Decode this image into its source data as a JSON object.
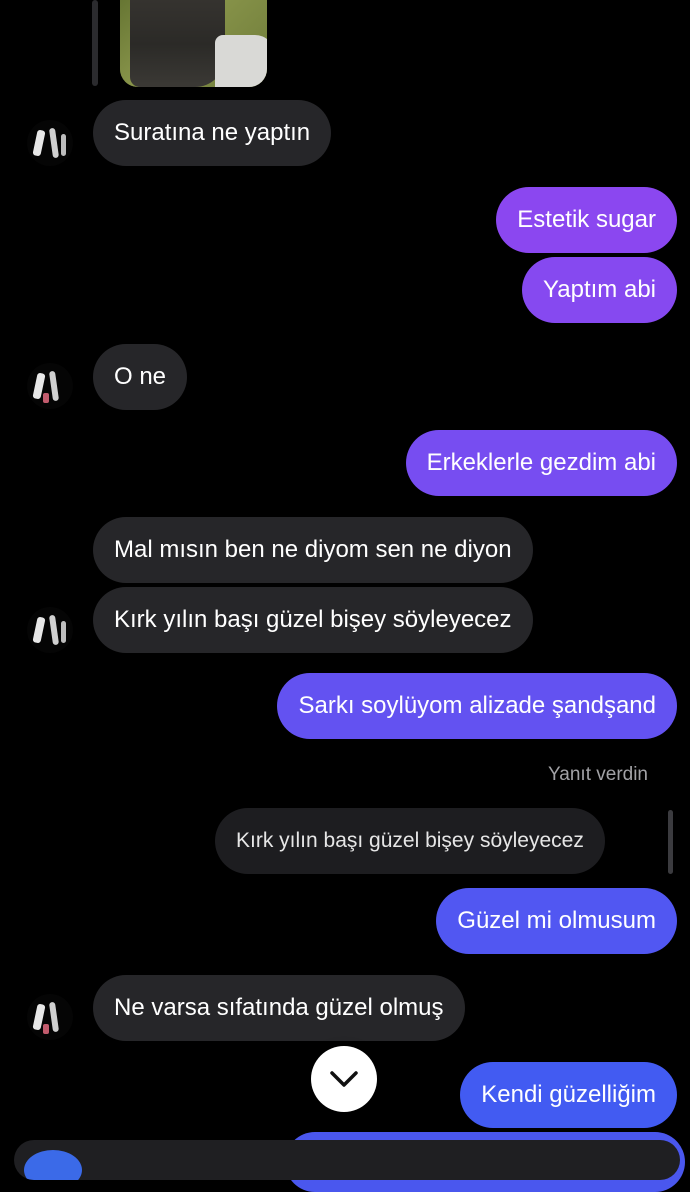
{
  "colors": {
    "background": "#000000",
    "incoming_bubble": "#262629",
    "outgoing_gradient_top": "#9b43f0",
    "outgoing_gradient_bottom": "#3f5cf2"
  },
  "messages": [
    {
      "dir": "in",
      "text": "Suratına ne yaptın"
    },
    {
      "dir": "out",
      "text": "Estetik sugar"
    },
    {
      "dir": "out",
      "text": "Yaptım abi"
    },
    {
      "dir": "in",
      "text": "O ne"
    },
    {
      "dir": "out",
      "text": "Erkeklerle gezdim abi"
    },
    {
      "dir": "in",
      "text": "Mal mısın ben ne diyom sen ne diyon"
    },
    {
      "dir": "in",
      "text": "Kırk yılın başı güzel bişey söyleyecez"
    },
    {
      "dir": "out",
      "text": "Sarkı soylüyom alizade şandşand"
    },
    {
      "dir": "out",
      "text": "Güzel mi olmusum"
    },
    {
      "dir": "in",
      "text": "Ne varsa sıfatında güzel olmuş"
    },
    {
      "dir": "out",
      "text": "Kendi güzelliğim"
    }
  ],
  "reply": {
    "label": "Yanıt verdin",
    "quoted_text": "Kırk yılın başı güzel bişey söyleyecez"
  },
  "icons": {
    "scroll_down": "chevron-down-icon",
    "avatar": "contact-avatar"
  }
}
